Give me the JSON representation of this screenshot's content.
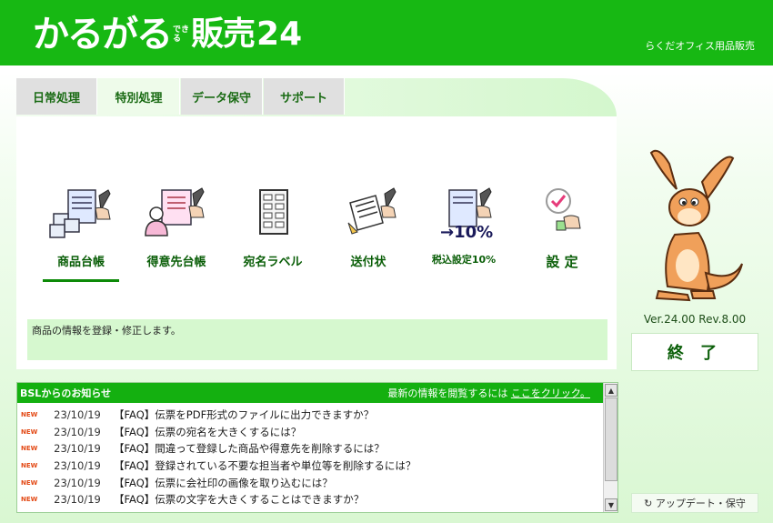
{
  "header": {
    "logo_main": "かるがる",
    "logo_small_1": "でき",
    "logo_small_2": "る",
    "logo_hanbai": "販売",
    "logo_num": "24",
    "company": "らくだオフィス用品販売"
  },
  "tabs": [
    {
      "label": "日常処理"
    },
    {
      "label": "特別処理"
    },
    {
      "label": "データ保守"
    },
    {
      "label": "サポート"
    }
  ],
  "functions": [
    {
      "label": "商品台帳",
      "icon": "product-ledger-icon"
    },
    {
      "label": "得意先台帳",
      "icon": "customer-ledger-icon"
    },
    {
      "label": "宛名ラベル",
      "icon": "address-label-icon"
    },
    {
      "label": "送付状",
      "icon": "cover-letter-icon"
    },
    {
      "label": "税込設定10%",
      "icon": "tax-setting-icon"
    },
    {
      "label": "設 定",
      "icon": "settings-icon"
    }
  ],
  "description": "商品の情報を登録・修正します。",
  "version": "Ver.24.00 Rev.8.00",
  "exit_label": "終 了",
  "update_label": "↻ アップデート・保守",
  "news": {
    "title": "BSLからのお知らせ",
    "link_prefix": "最新の情報を閲覧するには",
    "link_text": "ここをクリック。",
    "new_badge": "NEW",
    "items": [
      {
        "date": "23/10/19",
        "text": "【FAQ】伝票をPDF形式のファイルに出力できますか？"
      },
      {
        "date": "23/10/19",
        "text": "【FAQ】伝票の宛名を大きくするには？"
      },
      {
        "date": "23/10/19",
        "text": "【FAQ】間違って登録した商品や得意先を削除するには？"
      },
      {
        "date": "23/10/19",
        "text": "【FAQ】登録されている不要な担当者や単位等を削除するには？"
      },
      {
        "date": "23/10/19",
        "text": "【FAQ】伝票に会社印の画像を取り込むには？"
      },
      {
        "date": "23/10/19",
        "text": "【FAQ】伝票の文字を大きくすることはできますか？"
      }
    ]
  },
  "colors": {
    "brand_green": "#17b813",
    "label_green": "#0a5e08",
    "new_orange": "#e34a16"
  }
}
